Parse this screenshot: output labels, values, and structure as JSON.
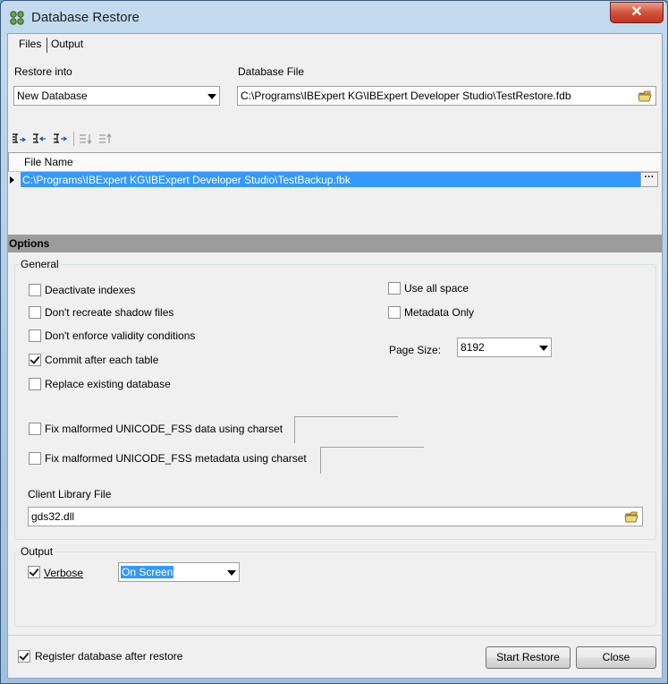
{
  "window": {
    "title": "Database Restore",
    "close_label": "✕"
  },
  "tabs": [
    "Files",
    "Output"
  ],
  "restore_into": {
    "label": "Restore into",
    "value": "New Database"
  },
  "database_file": {
    "label": "Database File",
    "value": "C:\\Programs\\IBExpert KG\\IBExpert Developer Studio\\TestRestore.fdb"
  },
  "grid": {
    "column_header": "File Name",
    "rows": [
      "C:\\Programs\\IBExpert KG\\IBExpert Developer Studio\\TestBackup.fbk"
    ],
    "ellipsis": "···"
  },
  "options": {
    "section_title": "Options",
    "general_title": "General",
    "checkboxes": [
      {
        "label": "Deactivate indexes",
        "checked": false
      },
      {
        "label": "Don't recreate shadow files",
        "checked": false
      },
      {
        "label": "Don't enforce validity conditions",
        "checked": false
      },
      {
        "label": "Commit after each table",
        "checked": true
      },
      {
        "label": "Replace existing database",
        "checked": false
      }
    ],
    "right_checkboxes": [
      {
        "label": "Use all space",
        "checked": false
      },
      {
        "label": "Metadata Only",
        "checked": false
      }
    ],
    "page_size": {
      "label": "Page Size:",
      "value": "8192"
    },
    "fix_data": {
      "label": "Fix malformed UNICODE_FSS data using charset",
      "checked": false,
      "value": ""
    },
    "fix_metadata": {
      "label": "Fix malformed UNICODE_FSS metadata using charset",
      "checked": false,
      "value": ""
    },
    "client_library": {
      "label": "Client Library File",
      "value": "gds32.dll"
    }
  },
  "output": {
    "title": "Output",
    "verbose": {
      "label": "Verbose",
      "checked": true
    },
    "mode": {
      "value": "On Screen"
    }
  },
  "footer": {
    "register": {
      "label": "Register database after restore",
      "checked": true
    },
    "start_label": "Start Restore",
    "close_label": "Close"
  }
}
